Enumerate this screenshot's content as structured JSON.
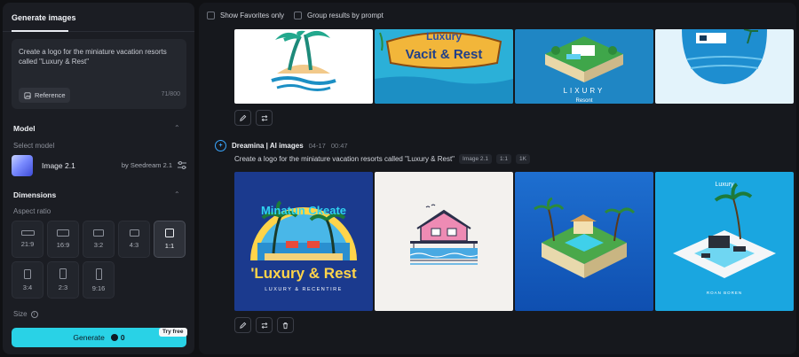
{
  "sidebar": {
    "tab": "Generate images",
    "prompt": "Create a logo for the miniature vacation resorts called \"Luxury & Rest\"",
    "reference_label": "Reference",
    "char_count": "71/800",
    "model_section": "Model",
    "select_model_label": "Select model",
    "model_name": "Image 2.1",
    "model_by": "by Seedream 2.1",
    "dimensions_section": "Dimensions",
    "aspect_ratio_label": "Aspect ratio",
    "ratios": [
      {
        "label": "21:9"
      },
      {
        "label": "16:9"
      },
      {
        "label": "3:2"
      },
      {
        "label": "4:3"
      },
      {
        "label": "1:1"
      },
      {
        "label": "3:4"
      },
      {
        "label": "2:3"
      },
      {
        "label": "9:16"
      }
    ],
    "selected_ratio": "1:1",
    "size_label": "Size",
    "generate_label": "Generate",
    "generate_cost": "0",
    "try_free": "Try free"
  },
  "main": {
    "show_favorites": "Show Favorites only",
    "group_results": "Group results by prompt",
    "row1_text": {
      "logo2_line1": "Luxury",
      "logo2_line2": "Vacit & Rest",
      "logo3_line1": "LIXURY",
      "logo3_line2": "Resont"
    },
    "generation": {
      "author": "Dreamina | AI images",
      "date": "04-17",
      "time": "00:47",
      "prompt": "Create a logo for the miniature vacation resorts called \"Luxury & Rest\"",
      "tags": [
        "Image 2.1",
        "1:1",
        "1K"
      ]
    },
    "row2_text": {
      "logo1_arc": "Minatun Ckeate",
      "logo1_main": "'Luxury & Rest",
      "logo1_sub": "LUXURY & RECENTIRE",
      "logo4_top": "Luxury",
      "logo4_bottom": "ROAN BOREN"
    }
  },
  "colors": {
    "accent": "#29d2e6",
    "background": "#101114",
    "panel": "#1b1d23",
    "main_panel": "#16181d"
  }
}
